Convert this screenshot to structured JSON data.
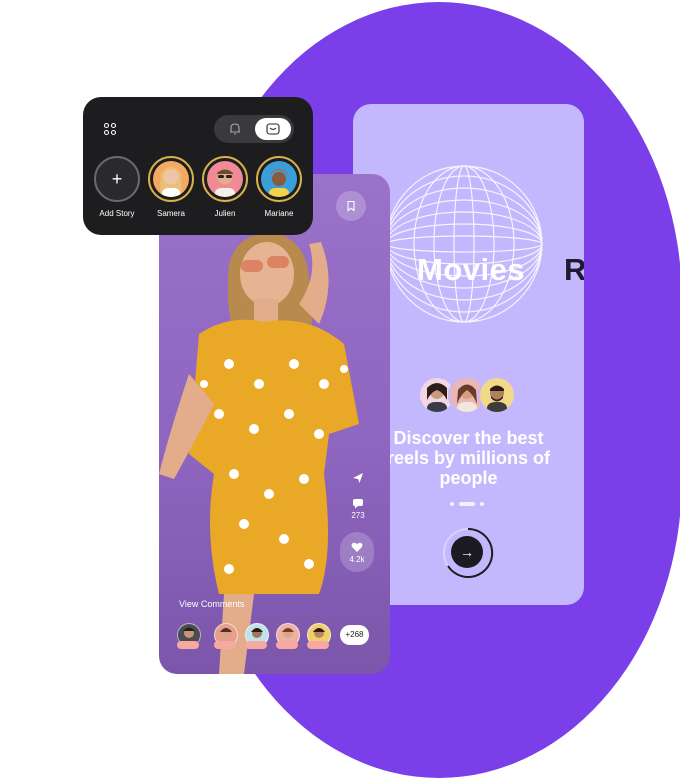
{
  "colors": {
    "blob": "#7b3fea",
    "onboarding_bg": "#c3b7fe",
    "card_dark": "#1d1d1f",
    "story_ring": "#d7b14b",
    "comment_tag": "#f6a9a0"
  },
  "stories_card": {
    "icons": [
      "grid-dots-icon",
      "bell-icon",
      "inbox-icon"
    ],
    "items": [
      {
        "label": "Add Story",
        "icon": "plus-icon"
      },
      {
        "label": "Samera"
      },
      {
        "label": "Julien"
      },
      {
        "label": "Mariane"
      }
    ]
  },
  "reel": {
    "bookmark_icon": "bookmark-icon",
    "share_icon": "send-icon",
    "comments_count": "273",
    "likes_count": "4.2k",
    "view_comments_label": "View Comments",
    "more_commenters": "+268"
  },
  "onboarding": {
    "title": "Movies",
    "next_title_partial": "R",
    "headline_line1": "Discover the best",
    "headline_line2": "reels by millions of",
    "headline_line3": "people",
    "pager_active_index": 1,
    "pager_count": 3,
    "next_button_icon": "arrow-right-icon"
  }
}
